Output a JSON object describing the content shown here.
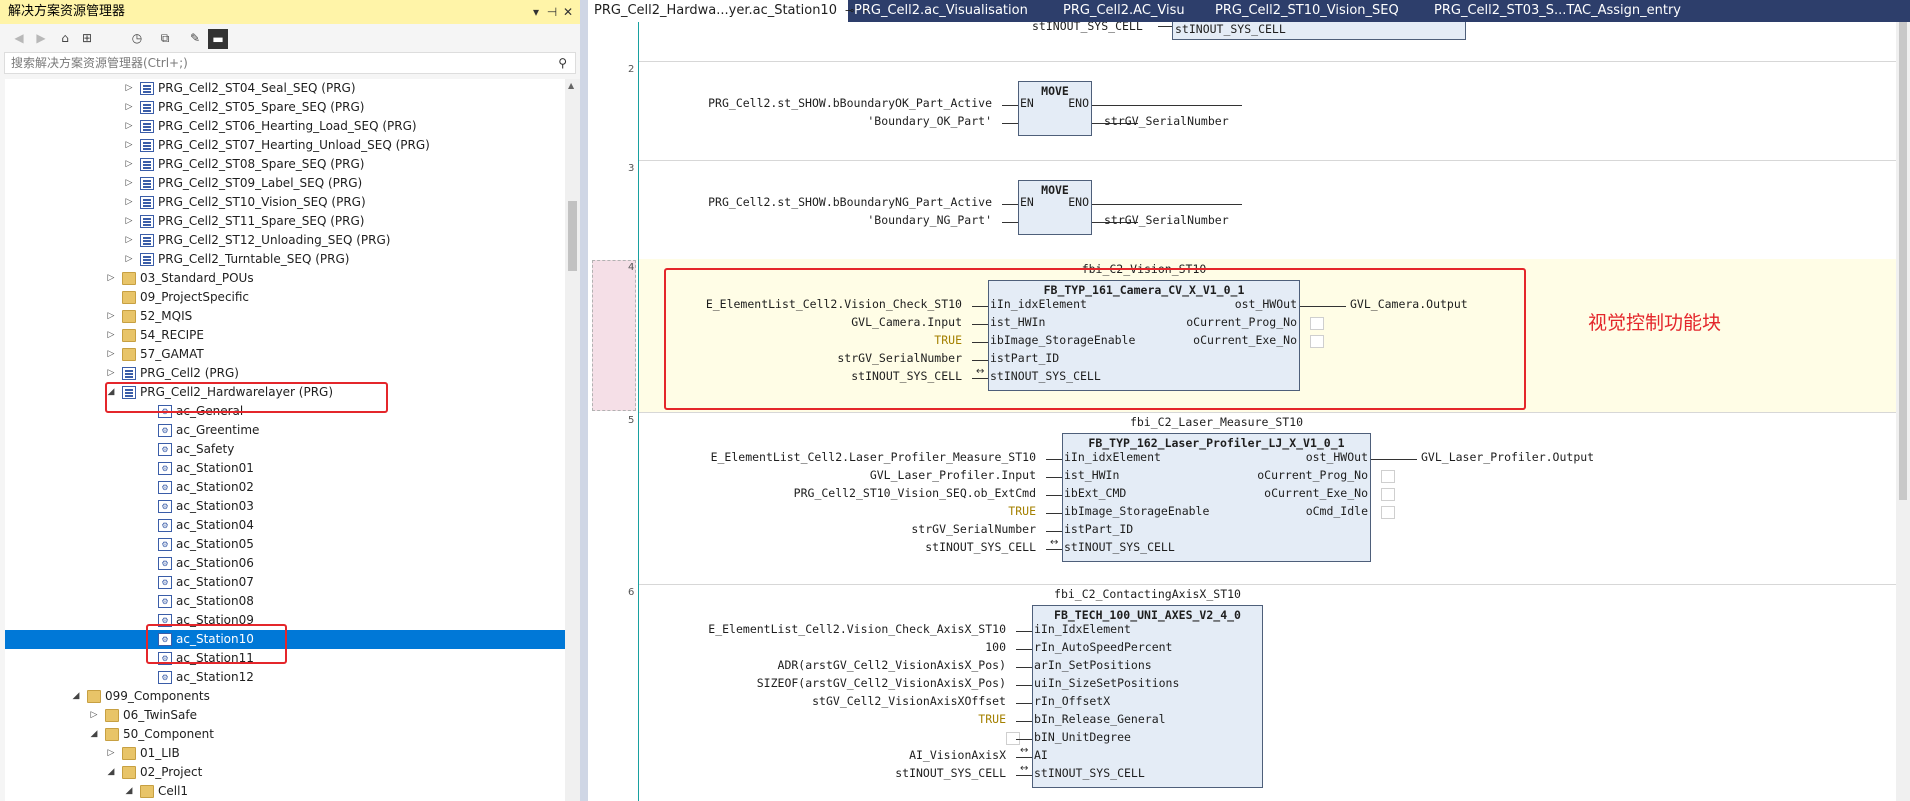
{
  "explorer": {
    "title": "解决方案资源管理器",
    "title_buttons": [
      "▾",
      "⊣",
      "✕"
    ],
    "search_placeholder": "搜索解决方案资源管理器(Ctrl+;)",
    "tree": [
      {
        "label": "PRG_Cell2_ST04_Seal_SEQ (PRG)",
        "icon": "prg-icon",
        "expander": "▷"
      },
      {
        "label": "PRG_Cell2_ST05_Spare_SEQ (PRG)",
        "icon": "prg-icon",
        "expander": "▷"
      },
      {
        "label": "PRG_Cell2_ST06_Hearting_Load_SEQ (PRG)",
        "icon": "prg-icon",
        "expander": "▷"
      },
      {
        "label": "PRG_Cell2_ST07_Hearting_Unload_SEQ (PRG)",
        "icon": "prg-icon",
        "expander": "▷"
      },
      {
        "label": "PRG_Cell2_ST08_Spare_SEQ (PRG)",
        "icon": "prg-icon",
        "expander": "▷"
      },
      {
        "label": "PRG_Cell2_ST09_Label_SEQ (PRG)",
        "icon": "prg-icon",
        "expander": "▷"
      },
      {
        "label": "PRG_Cell2_ST10_Vision_SEQ (PRG)",
        "icon": "prg-icon",
        "expander": "▷"
      },
      {
        "label": "PRG_Cell2_ST11_Spare_SEQ (PRG)",
        "icon": "prg-icon",
        "expander": "▷"
      },
      {
        "label": "PRG_Cell2_ST12_Unloading_SEQ (PRG)",
        "icon": "prg-icon",
        "expander": "▷"
      },
      {
        "label": "PRG_Cell2_Turntable_SEQ (PRG)",
        "icon": "prg-icon",
        "expander": "▷"
      },
      {
        "label": "03_Standard_POUs",
        "icon": "folder-icon",
        "expander": "▷"
      },
      {
        "label": "09_ProjectSpecific",
        "icon": "folder-icon",
        "expander": ""
      },
      {
        "label": "52_MQIS",
        "icon": "folder-icon",
        "expander": "▷"
      },
      {
        "label": "54_RECIPE",
        "icon": "folder-icon",
        "expander": "▷"
      },
      {
        "label": "57_GAMAT",
        "icon": "folder-icon",
        "expander": "▷"
      },
      {
        "label": "PRG_Cell2 (PRG)",
        "icon": "prg-icon",
        "expander": "▷"
      },
      {
        "label": "PRG_Cell2_Hardwarelayer (PRG)",
        "icon": "prg-icon",
        "expander": "◢"
      },
      {
        "label": "ac_General",
        "icon": "action-icon",
        "expander": ""
      },
      {
        "label": "ac_Greentime",
        "icon": "action-icon",
        "expander": ""
      },
      {
        "label": "ac_Safety",
        "icon": "action-icon",
        "expander": ""
      },
      {
        "label": "ac_Station01",
        "icon": "action-icon",
        "expander": ""
      },
      {
        "label": "ac_Station02",
        "icon": "action-icon",
        "expander": ""
      },
      {
        "label": "ac_Station03",
        "icon": "action-icon",
        "expander": ""
      },
      {
        "label": "ac_Station04",
        "icon": "action-icon",
        "expander": ""
      },
      {
        "label": "ac_Station05",
        "icon": "action-icon",
        "expander": ""
      },
      {
        "label": "ac_Station06",
        "icon": "action-icon",
        "expander": ""
      },
      {
        "label": "ac_Station07",
        "icon": "action-icon",
        "expander": ""
      },
      {
        "label": "ac_Station08",
        "icon": "action-icon",
        "expander": ""
      },
      {
        "label": "ac_Station09",
        "icon": "action-icon",
        "expander": ""
      },
      {
        "label": "ac_Station10",
        "icon": "action-icon",
        "expander": "",
        "selected": true
      },
      {
        "label": "ac_Station11",
        "icon": "action-icon",
        "expander": ""
      },
      {
        "label": "ac_Station12",
        "icon": "action-icon",
        "expander": ""
      },
      {
        "label": "099_Components",
        "icon": "folder-icon",
        "expander": "◢"
      },
      {
        "label": "06_TwinSafe",
        "icon": "folder-icon",
        "expander": "▷"
      },
      {
        "label": "50_Component",
        "icon": "folder-icon",
        "expander": "◢"
      },
      {
        "label": "01_LIB",
        "icon": "folder-icon",
        "expander": "▷"
      },
      {
        "label": "02_Project",
        "icon": "folder-icon",
        "expander": "◢"
      },
      {
        "label": "Cell1",
        "icon": "folder-icon",
        "expander": "◢"
      }
    ]
  },
  "tabs": [
    {
      "label": "PRG_Cell2_Hardwa...yer.ac_Station10",
      "active": true
    },
    {
      "label": "PRG_Cell2.ac_Visualisation"
    },
    {
      "label": "PRG_Cell2.AC_Visu"
    },
    {
      "label": "PRG_Cell2_ST10_Vision_SEQ"
    },
    {
      "label": "PRG_Cell2_ST03_S...TAC_Assign_entry"
    }
  ],
  "tab_icons": {
    "pin": "⊸",
    "close": "✕"
  },
  "editor": {
    "top_partial": {
      "input": "stINOUT_SYS_CELL",
      "output": "stINOUT_SYS_CELL"
    },
    "rungs": [
      {
        "number": "2",
        "fb_type": "MOVE",
        "inputs": [
          {
            "arg": "PRG_Cell2.st_SHOW.bBoundaryOK_Part_Active",
            "pin": "EN"
          },
          {
            "arg": "'Boundary_OK_Part'",
            "pin": ""
          }
        ],
        "outputs": [
          {
            "pin": "ENO",
            "arg": ""
          },
          {
            "pin": "",
            "arg": "strGV_SerialNumber"
          }
        ]
      },
      {
        "number": "3",
        "fb_type": "MOVE",
        "inputs": [
          {
            "arg": "PRG_Cell2.st_SHOW.bBoundaryNG_Part_Active",
            "pin": "EN"
          },
          {
            "arg": "'Boundary_NG_Part'",
            "pin": ""
          }
        ],
        "outputs": [
          {
            "pin": "ENO",
            "arg": ""
          },
          {
            "pin": "",
            "arg": "strGV_SerialNumber"
          }
        ]
      },
      {
        "number": "4",
        "instance": "fbi_C2_Vision_ST10",
        "fb_type": "FB_TYP_161_Camera_CV_X_V1_0_1",
        "inputs": [
          {
            "arg": "E_ElementList_Cell2.Vision_Check_ST10",
            "pin": "iIn_idxElement"
          },
          {
            "arg": "GVL_Camera.Input",
            "pin": "ist_HWIn"
          },
          {
            "arg": "TRUE",
            "pin": "ibImage_StorageEnable"
          },
          {
            "arg": "strGV_SerialNumber",
            "pin": "istPart_ID"
          },
          {
            "arg": "stINOUT_SYS_CELL",
            "pin": "stINOUT_SYS_CELL"
          }
        ],
        "outputs": [
          {
            "pin": "ost_HWOut",
            "arg": "GVL_Camera.Output"
          },
          {
            "pin": "oCurrent_Prog_No",
            "arg": ""
          },
          {
            "pin": "oCurrent_Exe_No",
            "arg": ""
          }
        ],
        "annotation": "视觉控制功能块"
      },
      {
        "number": "5",
        "instance": "fbi_C2_Laser_Measure_ST10",
        "fb_type": "FB_TYP_162_Laser_Profiler_LJ_X_V1_0_1",
        "inputs": [
          {
            "arg": "E_ElementList_Cell2.Laser_Profiler_Measure_ST10",
            "pin": "iIn_idxElement"
          },
          {
            "arg": "GVL_Laser_Profiler.Input",
            "pin": "ist_HWIn"
          },
          {
            "arg": "PRG_Cell2_ST10_Vision_SEQ.ob_ExtCmd",
            "pin": "ibExt_CMD"
          },
          {
            "arg": "TRUE",
            "pin": "ibImage_StorageEnable"
          },
          {
            "arg": "strGV_SerialNumber",
            "pin": "istPart_ID"
          },
          {
            "arg": "stINOUT_SYS_CELL",
            "pin": "stINOUT_SYS_CELL"
          }
        ],
        "outputs": [
          {
            "pin": "ost_HWOut",
            "arg": "GVL_Laser_Profiler.Output"
          },
          {
            "pin": "oCurrent_Prog_No",
            "arg": ""
          },
          {
            "pin": "oCurrent_Exe_No",
            "arg": ""
          },
          {
            "pin": "oCmd_Idle",
            "arg": ""
          }
        ]
      },
      {
        "number": "6",
        "instance": "fbi_C2_ContactingAxisX_ST10",
        "fb_type": "FB_TECH_100_UNI_AXES_V2_4_0",
        "inputs": [
          {
            "arg": "E_ElementList_Cell2.Vision_Check_AxisX_ST10",
            "pin": "iIn_IdxElement"
          },
          {
            "arg": "100",
            "pin": "rIn_AutoSpeedPercent"
          },
          {
            "arg": "ADR(arstGV_Cell2_VisionAxisX_Pos)",
            "pin": "arIn_SetPositions"
          },
          {
            "arg": "SIZEOF(arstGV_Cell2_VisionAxisX_Pos)",
            "pin": "uiIn_SizeSetPositions"
          },
          {
            "arg": "stGV_Cell2_VisionAxisXOffset",
            "pin": "rIn_OffsetX"
          },
          {
            "arg": "TRUE",
            "pin": "bIn_Release_General"
          },
          {
            "arg": "",
            "pin": "bIN_UnitDegree"
          },
          {
            "arg": "AI_VisionAxisX",
            "pin": "AI"
          },
          {
            "arg": "stINOUT_SYS_CELL",
            "pin": "stINOUT_SYS_CELL"
          }
        ],
        "outputs": []
      }
    ]
  },
  "colors": {
    "title_bar": "#fff4a8",
    "tab_strip": "#2d3e6b",
    "selection": "#0078d7",
    "fb_fill": "#e4ecf6",
    "highlight": "#e4262b",
    "rung_highlight": "#fffde6"
  }
}
